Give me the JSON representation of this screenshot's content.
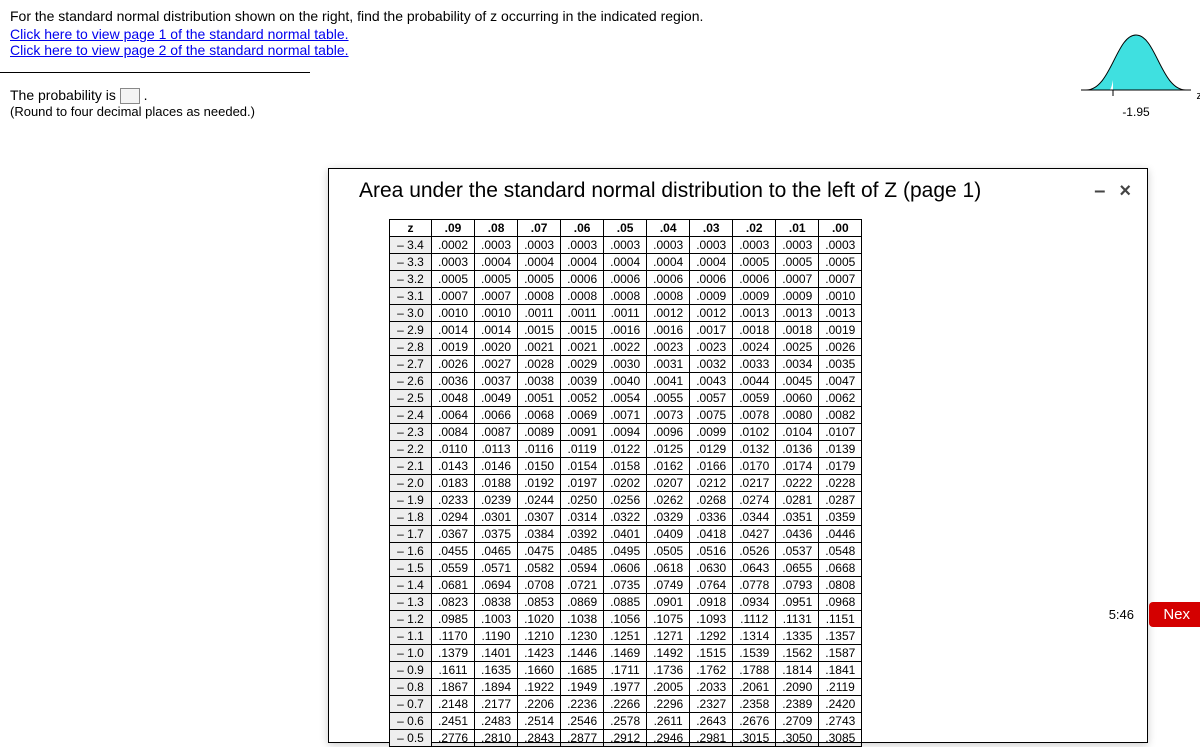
{
  "question": {
    "prompt": "For the standard normal distribution shown on the right, find the probability of z occurring in the indicated region.",
    "link1": "Click here to view page 1 of the standard normal table.",
    "link2": "Click here to view page 2 of the standard normal table.",
    "answer_lead": "The probability is ",
    "answer_trail": ".",
    "round_note": "(Round to four decimal places as needed.)"
  },
  "curve": {
    "marker": "-1.95",
    "axis": "z"
  },
  "modal": {
    "title": "Area under the standard normal distribution to the left of Z (page 1)",
    "minimize": "–",
    "close": "×"
  },
  "time": "5:46",
  "next_label": "Nex",
  "table": {
    "headers": [
      "z",
      ".09",
      ".08",
      ".07",
      ".06",
      ".05",
      ".04",
      ".03",
      ".02",
      ".01",
      ".00"
    ],
    "rows": [
      {
        "z": "– 3.4",
        "v": [
          ".0002",
          ".0003",
          ".0003",
          ".0003",
          ".0003",
          ".0003",
          ".0003",
          ".0003",
          ".0003",
          ".0003"
        ]
      },
      {
        "z": "– 3.3",
        "v": [
          ".0003",
          ".0004",
          ".0004",
          ".0004",
          ".0004",
          ".0004",
          ".0004",
          ".0005",
          ".0005",
          ".0005"
        ]
      },
      {
        "z": "– 3.2",
        "v": [
          ".0005",
          ".0005",
          ".0005",
          ".0006",
          ".0006",
          ".0006",
          ".0006",
          ".0006",
          ".0007",
          ".0007"
        ]
      },
      {
        "z": "– 3.1",
        "v": [
          ".0007",
          ".0007",
          ".0008",
          ".0008",
          ".0008",
          ".0008",
          ".0009",
          ".0009",
          ".0009",
          ".0010"
        ]
      },
      {
        "z": "– 3.0",
        "v": [
          ".0010",
          ".0010",
          ".0011",
          ".0011",
          ".0011",
          ".0012",
          ".0012",
          ".0013",
          ".0013",
          ".0013"
        ]
      },
      {
        "z": "– 2.9",
        "v": [
          ".0014",
          ".0014",
          ".0015",
          ".0015",
          ".0016",
          ".0016",
          ".0017",
          ".0018",
          ".0018",
          ".0019"
        ]
      },
      {
        "z": "– 2.8",
        "v": [
          ".0019",
          ".0020",
          ".0021",
          ".0021",
          ".0022",
          ".0023",
          ".0023",
          ".0024",
          ".0025",
          ".0026"
        ]
      },
      {
        "z": "– 2.7",
        "v": [
          ".0026",
          ".0027",
          ".0028",
          ".0029",
          ".0030",
          ".0031",
          ".0032",
          ".0033",
          ".0034",
          ".0035"
        ]
      },
      {
        "z": "– 2.6",
        "v": [
          ".0036",
          ".0037",
          ".0038",
          ".0039",
          ".0040",
          ".0041",
          ".0043",
          ".0044",
          ".0045",
          ".0047"
        ]
      },
      {
        "z": "– 2.5",
        "v": [
          ".0048",
          ".0049",
          ".0051",
          ".0052",
          ".0054",
          ".0055",
          ".0057",
          ".0059",
          ".0060",
          ".0062"
        ]
      },
      {
        "z": "– 2.4",
        "v": [
          ".0064",
          ".0066",
          ".0068",
          ".0069",
          ".0071",
          ".0073",
          ".0075",
          ".0078",
          ".0080",
          ".0082"
        ]
      },
      {
        "z": "– 2.3",
        "v": [
          ".0084",
          ".0087",
          ".0089",
          ".0091",
          ".0094",
          ".0096",
          ".0099",
          ".0102",
          ".0104",
          ".0107"
        ]
      },
      {
        "z": "– 2.2",
        "v": [
          ".0110",
          ".0113",
          ".0116",
          ".0119",
          ".0122",
          ".0125",
          ".0129",
          ".0132",
          ".0136",
          ".0139"
        ]
      },
      {
        "z": "– 2.1",
        "v": [
          ".0143",
          ".0146",
          ".0150",
          ".0154",
          ".0158",
          ".0162",
          ".0166",
          ".0170",
          ".0174",
          ".0179"
        ]
      },
      {
        "z": "– 2.0",
        "v": [
          ".0183",
          ".0188",
          ".0192",
          ".0197",
          ".0202",
          ".0207",
          ".0212",
          ".0217",
          ".0222",
          ".0228"
        ]
      },
      {
        "z": "– 1.9",
        "v": [
          ".0233",
          ".0239",
          ".0244",
          ".0250",
          ".0256",
          ".0262",
          ".0268",
          ".0274",
          ".0281",
          ".0287"
        ]
      },
      {
        "z": "– 1.8",
        "v": [
          ".0294",
          ".0301",
          ".0307",
          ".0314",
          ".0322",
          ".0329",
          ".0336",
          ".0344",
          ".0351",
          ".0359"
        ]
      },
      {
        "z": "– 1.7",
        "v": [
          ".0367",
          ".0375",
          ".0384",
          ".0392",
          ".0401",
          ".0409",
          ".0418",
          ".0427",
          ".0436",
          ".0446"
        ]
      },
      {
        "z": "– 1.6",
        "v": [
          ".0455",
          ".0465",
          ".0475",
          ".0485",
          ".0495",
          ".0505",
          ".0516",
          ".0526",
          ".0537",
          ".0548"
        ]
      },
      {
        "z": "– 1.5",
        "v": [
          ".0559",
          ".0571",
          ".0582",
          ".0594",
          ".0606",
          ".0618",
          ".0630",
          ".0643",
          ".0655",
          ".0668"
        ]
      },
      {
        "z": "– 1.4",
        "v": [
          ".0681",
          ".0694",
          ".0708",
          ".0721",
          ".0735",
          ".0749",
          ".0764",
          ".0778",
          ".0793",
          ".0808"
        ]
      },
      {
        "z": "– 1.3",
        "v": [
          ".0823",
          ".0838",
          ".0853",
          ".0869",
          ".0885",
          ".0901",
          ".0918",
          ".0934",
          ".0951",
          ".0968"
        ]
      },
      {
        "z": "– 1.2",
        "v": [
          ".0985",
          ".1003",
          ".1020",
          ".1038",
          ".1056",
          ".1075",
          ".1093",
          ".1112",
          ".1131",
          ".1151"
        ]
      },
      {
        "z": "– 1.1",
        "v": [
          ".1170",
          ".1190",
          ".1210",
          ".1230",
          ".1251",
          ".1271",
          ".1292",
          ".1314",
          ".1335",
          ".1357"
        ]
      },
      {
        "z": "– 1.0",
        "v": [
          ".1379",
          ".1401",
          ".1423",
          ".1446",
          ".1469",
          ".1492",
          ".1515",
          ".1539",
          ".1562",
          ".1587"
        ]
      },
      {
        "z": "– 0.9",
        "v": [
          ".1611",
          ".1635",
          ".1660",
          ".1685",
          ".1711",
          ".1736",
          ".1762",
          ".1788",
          ".1814",
          ".1841"
        ]
      },
      {
        "z": "– 0.8",
        "v": [
          ".1867",
          ".1894",
          ".1922",
          ".1949",
          ".1977",
          ".2005",
          ".2033",
          ".2061",
          ".2090",
          ".2119"
        ]
      },
      {
        "z": "– 0.7",
        "v": [
          ".2148",
          ".2177",
          ".2206",
          ".2236",
          ".2266",
          ".2296",
          ".2327",
          ".2358",
          ".2389",
          ".2420"
        ]
      },
      {
        "z": "– 0.6",
        "v": [
          ".2451",
          ".2483",
          ".2514",
          ".2546",
          ".2578",
          ".2611",
          ".2643",
          ".2676",
          ".2709",
          ".2743"
        ]
      },
      {
        "z": "– 0.5",
        "v": [
          ".2776",
          ".2810",
          ".2843",
          ".2877",
          ".2912",
          ".2946",
          ".2981",
          ".3015",
          ".3050",
          ".3085"
        ]
      }
    ]
  }
}
